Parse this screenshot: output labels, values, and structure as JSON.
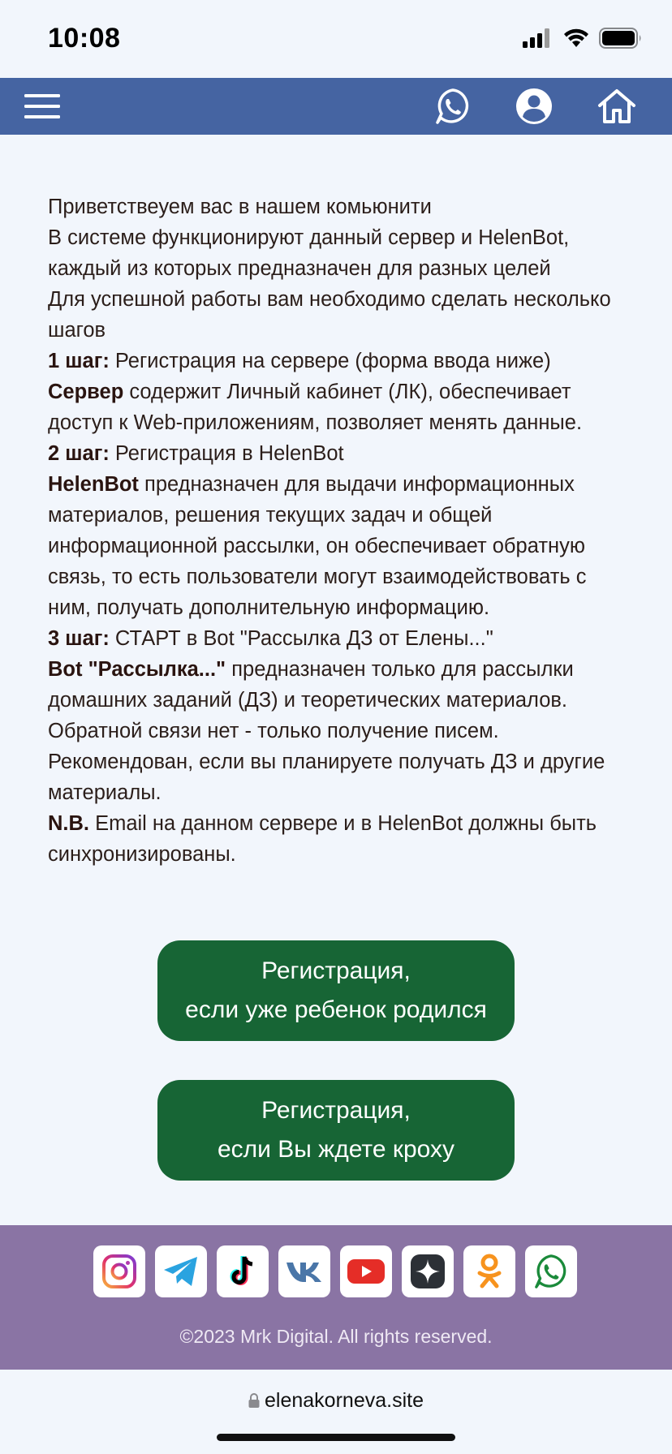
{
  "status": {
    "time": "10:08"
  },
  "nav": {
    "menu_icon": "hamburger-menu-icon",
    "whatsapp_icon": "whatsapp-icon",
    "user_icon": "user-account-icon",
    "home_icon": "home-icon",
    "color": "#4564a2"
  },
  "intro": {
    "p1": "Приветствеуем вас в нашем комьюнити",
    "p2": "В системе функционируют данный сервер и HelenBot, каждый из которых предназначен для разных целей",
    "p3": "Для успешной работы вам необходимо сделать несколько шагов",
    "step1_label": "1 шаг:",
    "step1_text": " Регистрация на сервере (форма ввода ниже)",
    "server_label": "Сервер",
    "server_text": " содержит Личный кабинет (ЛК), обеспечивает доступ к Web-приложениям, позволяет менять данные.",
    "step2_label": "2 шаг:",
    "step2_text": " Регистрация в HelenBot",
    "helenbot_label": "HelenBot",
    "helenbot_text": " предназначен для выдачи информационных материалов, решения текущих задач и общей информационной рассылки, он обеспечивает обратную связь, то есть пользователи могут взаимодействовать с ним, получать дополнительную информацию.",
    "step3_label": "3 шаг:",
    "step3_text": " СТАРТ в Bot \"Рассылка ДЗ от Елены...\"",
    "bot_label": "Bot \"Рассылка...\"",
    "bot_text": " предназначен только для рассылки домашних заданий (ДЗ) и теоретических материалов. Обратной связи нет - только получение писем. Рекомендован, если вы планируете получать ДЗ и другие материалы.",
    "nb_label": "N.B.",
    "nb_text": " Email на данном сервере и в HelenBot должны быть синхронизированы."
  },
  "buttons": {
    "reg_born_line1": "Регистрация,",
    "reg_born_line2": "если уже ребенок родился",
    "reg_wait_line1": "Регистрация,",
    "reg_wait_line2": "если Вы ждете кроху",
    "color": "#176535"
  },
  "footer": {
    "socials": [
      "instagram-icon",
      "telegram-icon",
      "tiktok-icon",
      "vk-icon",
      "youtube-icon",
      "dzen-icon",
      "odnoklassniki-icon",
      "whatsapp-icon"
    ],
    "copyright": "©2023 Mrk Digital. All rights reserved.",
    "color": "#8a74a4"
  },
  "browser": {
    "url": "elenakorneva.site"
  }
}
